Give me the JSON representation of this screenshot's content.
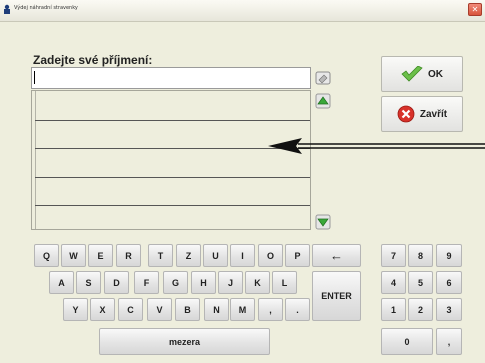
{
  "window": {
    "title": "Výdej náhradní stravenky",
    "close_glyph": "✕"
  },
  "form": {
    "prompt": "Zadejte své příjmení:",
    "surname_value": "",
    "icons": [
      "clear-icon",
      "up-icon",
      "down-icon"
    ]
  },
  "buttons": {
    "ok_label": "OK",
    "close_label": "Zavřít"
  },
  "keyboard": {
    "row1": [
      "Q",
      "W",
      "E",
      "R",
      "T",
      "Z",
      "U",
      "I",
      "O",
      "P"
    ],
    "row2": [
      "A",
      "S",
      "D",
      "F",
      "G",
      "H",
      "J",
      "K",
      "L"
    ],
    "row3": [
      "Y",
      "X",
      "C",
      "V",
      "B",
      "N",
      "M",
      ",",
      "."
    ],
    "backspace_glyph": "←",
    "enter_label": "ENTER",
    "space_label": "mezera"
  },
  "numpad": {
    "row1": [
      "7",
      "8",
      "9"
    ],
    "row2": [
      "4",
      "5",
      "6"
    ],
    "row3": [
      "1",
      "2",
      "3"
    ],
    "row4": [
      "0",
      ","
    ]
  },
  "colors": {
    "background": "#eeeedd",
    "ok_check": "#6cc04a",
    "close_red": "#d8322a",
    "scroll_green": "#3aa83a"
  }
}
